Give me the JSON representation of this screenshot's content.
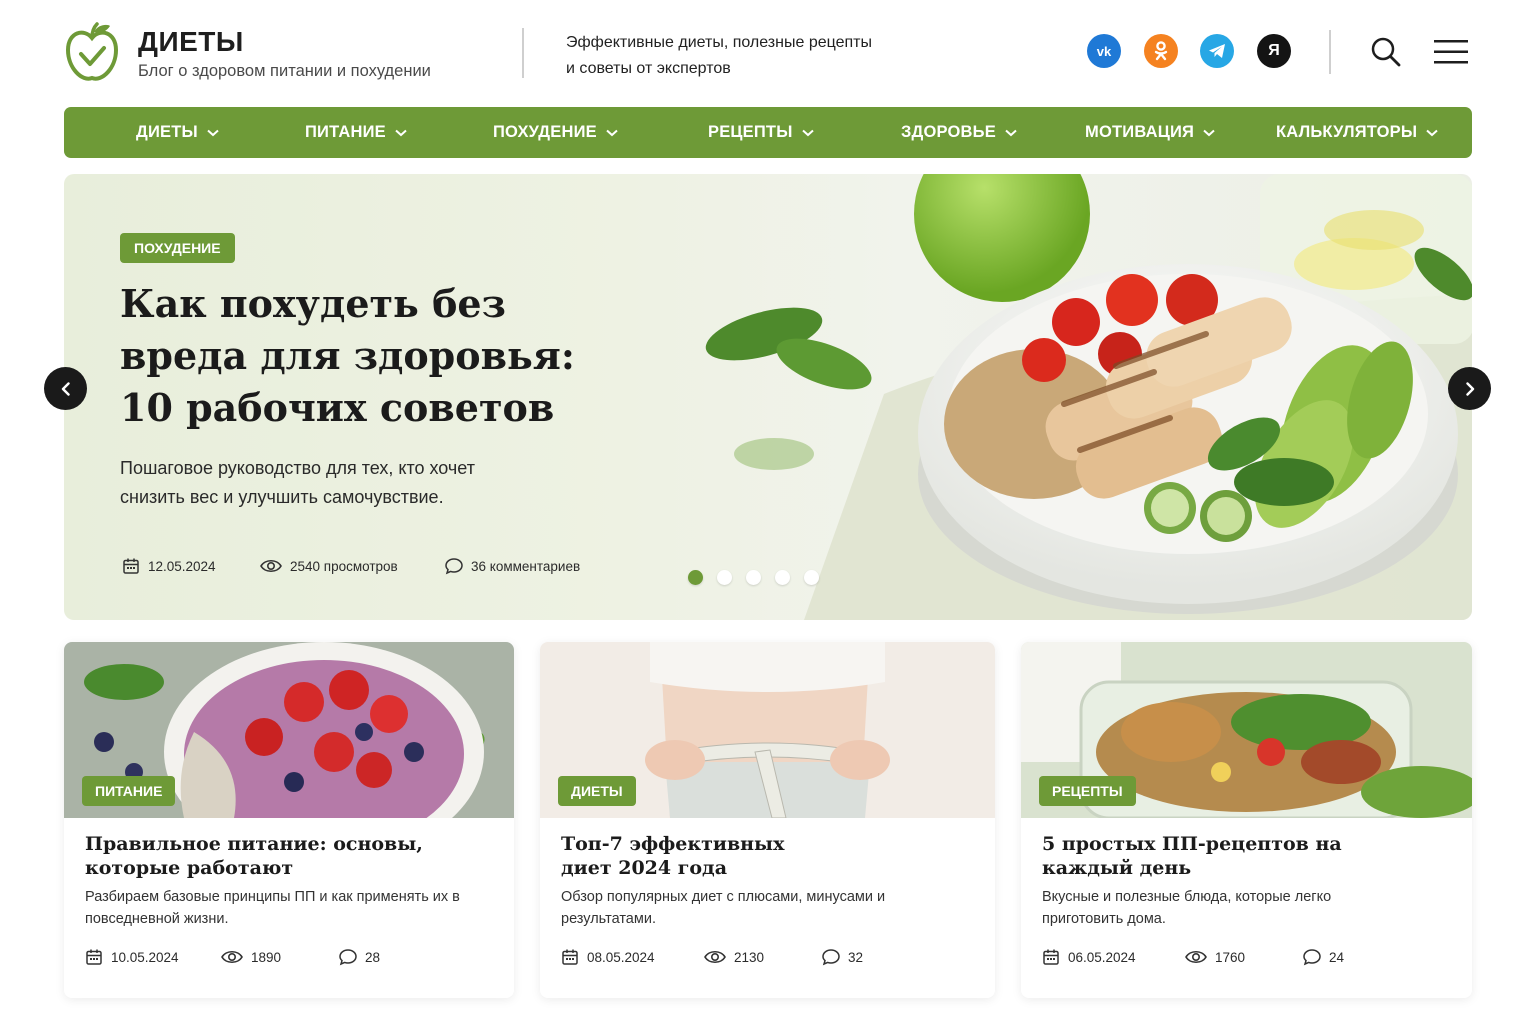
{
  "brand": {
    "title": "ДИЕТЫ",
    "subtitle": "Блог о здоровом питании и похудении",
    "tagline_line1": "Эффективные диеты, полезные рецепты",
    "tagline_line2": "и советы от экспертов",
    "accent_color": "#6e9a37"
  },
  "social": [
    {
      "name": "vk",
      "label": "vk",
      "color": "#1f79d6"
    },
    {
      "name": "ok",
      "label": "ок",
      "color": "#f58220"
    },
    {
      "name": "telegram",
      "label": "",
      "color": "#27a7e5"
    },
    {
      "name": "yandex",
      "label": "Я",
      "color": "#141414"
    }
  ],
  "nav": [
    {
      "label": "ДИЕТЫ"
    },
    {
      "label": "ПИТАНИЕ"
    },
    {
      "label": "ПОХУДЕНИЕ"
    },
    {
      "label": "РЕЦЕПТЫ"
    },
    {
      "label": "ЗДОРОВЬЕ"
    },
    {
      "label": "МОТИВАЦИЯ"
    },
    {
      "label": "КАЛЬКУЛЯТОРЫ"
    }
  ],
  "hero": {
    "tag": "ПОХУДЕНИЕ",
    "title": "Как похудеть без вреда для здоровья: 10 рабочих советов",
    "description": "Пошаговое руководство для тех, кто хочет снизить вес и улучшить самочувствие.",
    "date": "12.05.2024",
    "views": "2540 просмотров",
    "comments": "36 комментариев",
    "slides_total": 5,
    "active_slide": 1
  },
  "cards": [
    {
      "tag": "ПИТАНИЕ",
      "title": "Правильное питание: основы, которые работают",
      "description": "Разбираем базовые принципы ПП и как применять их в повседневной жизни.",
      "date": "10.05.2024",
      "views": "1890",
      "comments": "28"
    },
    {
      "tag": "ДИЕТЫ",
      "title": "Топ-7 эффективных диет 2024 года",
      "description": "Обзор популярных диет с плюсами, минусами и результатами.",
      "date": "08.05.2024",
      "views": "2130",
      "comments": "32"
    },
    {
      "tag": "РЕЦЕПТЫ",
      "title": "5 простых ПП-рецептов на каждый день",
      "description": "Вкусные и полезные блюда, которые легко приготовить дома.",
      "date": "06.05.2024",
      "views": "1760",
      "comments": "24"
    }
  ]
}
